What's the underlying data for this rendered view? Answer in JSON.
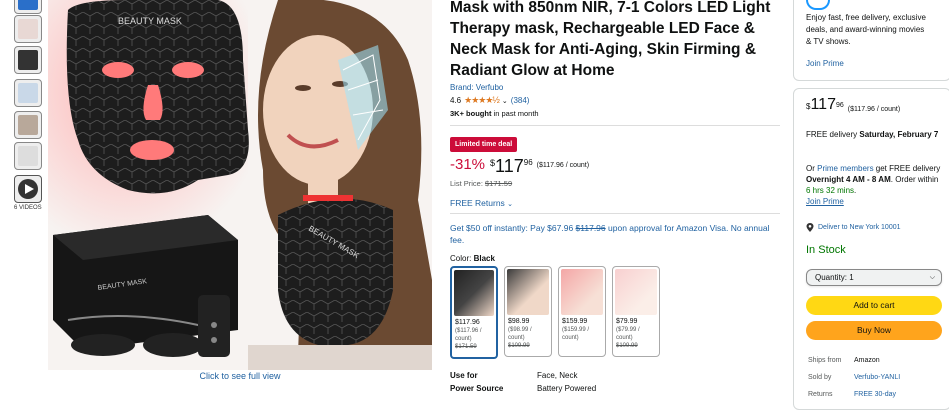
{
  "gallery": {
    "video_count_label": "6 VIDEOS",
    "click_to_see": "Click to see full view",
    "mask_label": "BEAUTY MASK",
    "box_label": "BEAUTY MASK",
    "neck_label": "BEAUTY MASK"
  },
  "product": {
    "title": "Mask with 850nm NIR, 7-1 Colors LED Light Therapy mask, Rechargeable LED Face & Neck Mask for Anti-Aging, Skin Firming & Radiant Glow at Home",
    "brand": "Brand: Verfubo",
    "rating": "4.6",
    "stars": "★★★★½",
    "rating_count": "(384)",
    "bought_bold": "3K+ bought",
    "bought_rest": " in past month",
    "deal_badge": "Limited time deal",
    "discount": "-31%",
    "price_symbol": "$",
    "price_whole": "117",
    "price_fraction": "96",
    "price_per_unit": "($117.96 / count)",
    "list_price_label": "List Price: ",
    "list_price": "$171.59",
    "returns": "FREE Returns",
    "offer_prefix": "Get $50 off instantly: Pay $67.96 ",
    "offer_strike": "$117.96",
    "offer_suffix": " upon approval for Amazon Visa. No annual fee.",
    "color_label": "Color: ",
    "color_value": "Black",
    "swatches": [
      {
        "price": "$117.96",
        "unit": "($117.96 /",
        "unit2": "count)",
        "list": "$171.59"
      },
      {
        "price": "$98.99",
        "unit": "($98.99 /",
        "unit2": "count)",
        "list": "$109.99"
      },
      {
        "price": "$159.99",
        "unit": "($159.99 /",
        "unit2": "count)",
        "list": ""
      },
      {
        "price": "$79.99",
        "unit": "($79.99 /",
        "unit2": "count)",
        "list": "$109.99"
      }
    ],
    "specs": [
      {
        "key": "Use for",
        "value": "Face, Neck"
      },
      {
        "key": "Power Source",
        "value": "Battery Powered"
      }
    ]
  },
  "prime_card": {
    "text": "Enjoy fast, free delivery, exclusive deals, and award-winning movies & TV shows.",
    "join": "Join Prime"
  },
  "buybox": {
    "price_symbol": "$",
    "price_whole": "117",
    "price_fraction": "96",
    "price_per_unit": "($117.96 / count)",
    "delivery_prefix": "FREE delivery ",
    "delivery_date": "Saturday, February 7",
    "fast_or": "Or ",
    "prime_members": "Prime members",
    "fast_mid": " get FREE delivery ",
    "fast_bold": "Overnight 4 AM - 8 AM",
    "fast_order": ". Order within ",
    "fast_time": "6 hrs 32 mins",
    "fast_end": ".",
    "join_prime": "Join Prime",
    "deliver_to": "Deliver to New York 10001",
    "in_stock": "In Stock",
    "quantity": "Quantity: 1",
    "add_to_cart": "Add to cart",
    "buy_now": "Buy Now",
    "info": [
      {
        "key": "Ships from",
        "value": "Amazon"
      },
      {
        "key": "Sold by",
        "value": "Verfubo-YANLI"
      },
      {
        "key": "Returns",
        "value": "FREE 30-day"
      }
    ]
  },
  "colors": {
    "link": "#2162a1",
    "deal": "#cc0c39",
    "stock": "#007600",
    "cart": "#ffd814",
    "buy": "#ffa41c"
  }
}
